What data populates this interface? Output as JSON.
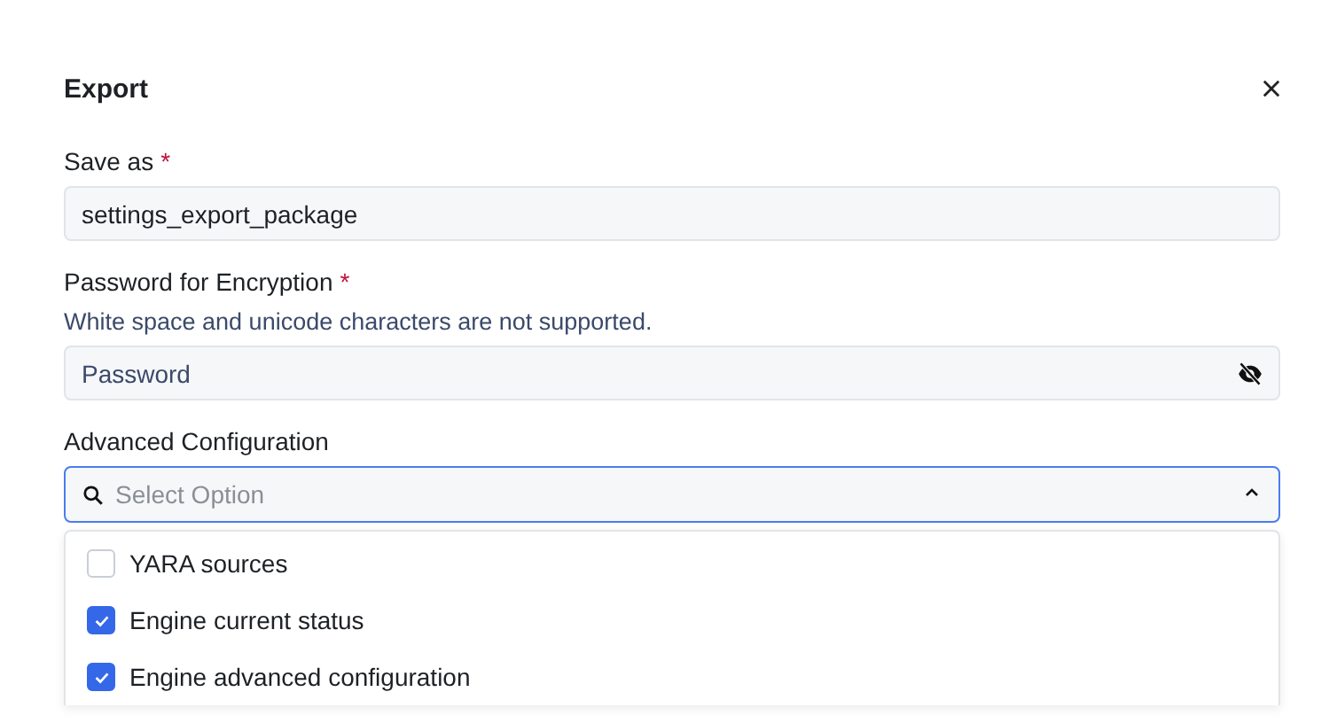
{
  "dialog": {
    "title": "Export"
  },
  "fields": [
    {
      "kind": "text",
      "label": "Save as",
      "required_mark": "*",
      "value": "settings_export_package"
    },
    {
      "kind": "password",
      "label": "Password for Encryption",
      "required_mark": "*",
      "hint": "White space and unicode characters are not supported.",
      "placeholder": "Password"
    },
    {
      "kind": "select",
      "label": "Advanced Configuration",
      "placeholder": "Select Option",
      "expanded": true,
      "options": [
        {
          "label": "YARA sources",
          "checked": false
        },
        {
          "label": "Engine current status",
          "checked": true
        },
        {
          "label": "Engine advanced configuration",
          "checked": true
        }
      ]
    }
  ]
}
